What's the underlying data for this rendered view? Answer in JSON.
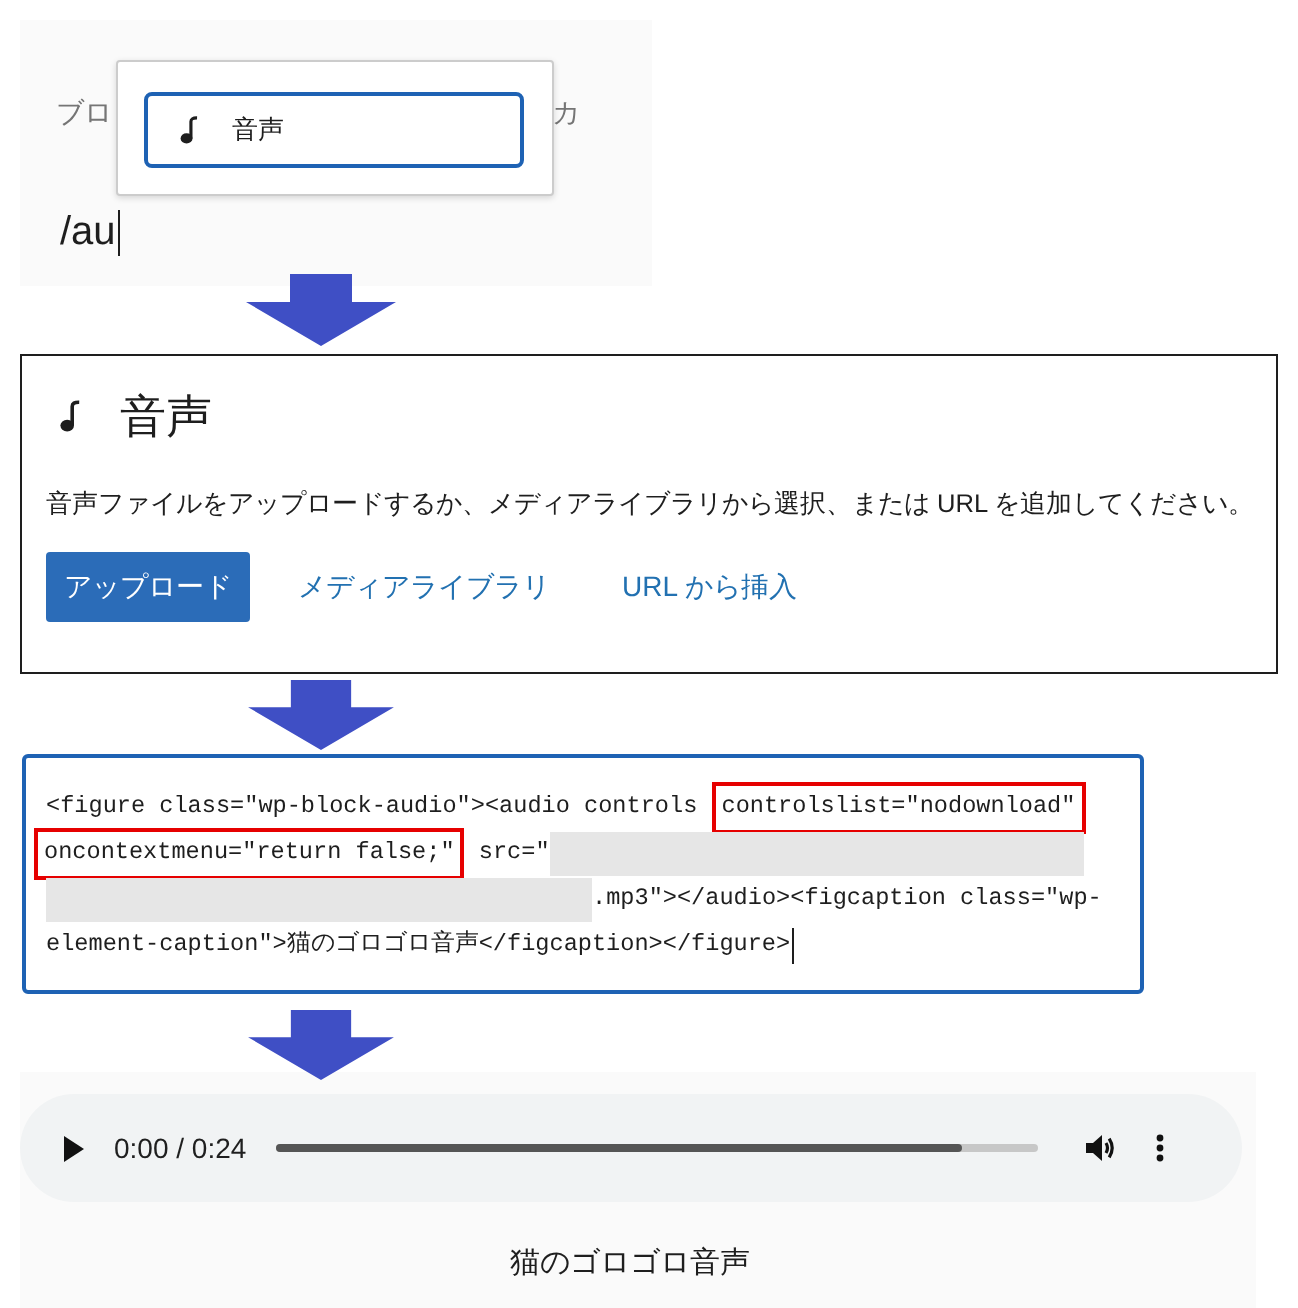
{
  "block_inserter": {
    "placeholder_fragments": [
      "ブロ",
      "カ"
    ],
    "typed_text": "/au",
    "focused": true,
    "popup_items": [
      {
        "label": "音声",
        "selected": true
      }
    ]
  },
  "audio_block": {
    "title": "音声",
    "description": "音声ファイルをアップロードするか、メディアライブラリから選択、または URL を追加してください。",
    "buttons": [
      {
        "label": "アップロード",
        "kind": "primary"
      },
      {
        "label": "メディアライブラリ",
        "kind": "link"
      },
      {
        "label": "URL から挿入",
        "kind": "link"
      }
    ]
  },
  "code_editor": {
    "focused": true,
    "lines": [
      [
        {
          "kind": "text",
          "text": "<figure class=\"wp-block-audio\"><audio controls "
        },
        {
          "kind": "highlight",
          "text": "controlslist=\"nodownload\""
        }
      ],
      [
        {
          "kind": "highlight",
          "text": "oncontextmenu=\"return false;\""
        },
        {
          "kind": "text",
          "text": " src=\""
        },
        {
          "kind": "redacted"
        }
      ],
      [
        {
          "kind": "redacted"
        },
        {
          "kind": "text",
          "text": ".mp3\"></audio><figcaption class=\"wp-"
        }
      ],
      [
        {
          "kind": "text",
          "text": "element-caption\">猫のゴロゴロ音声</figcaption></figure>"
        }
      ]
    ]
  },
  "audio_player": {
    "time": "0:00 / 0:24",
    "level": 0.9,
    "caption": "猫のゴロゴロ音声"
  }
}
